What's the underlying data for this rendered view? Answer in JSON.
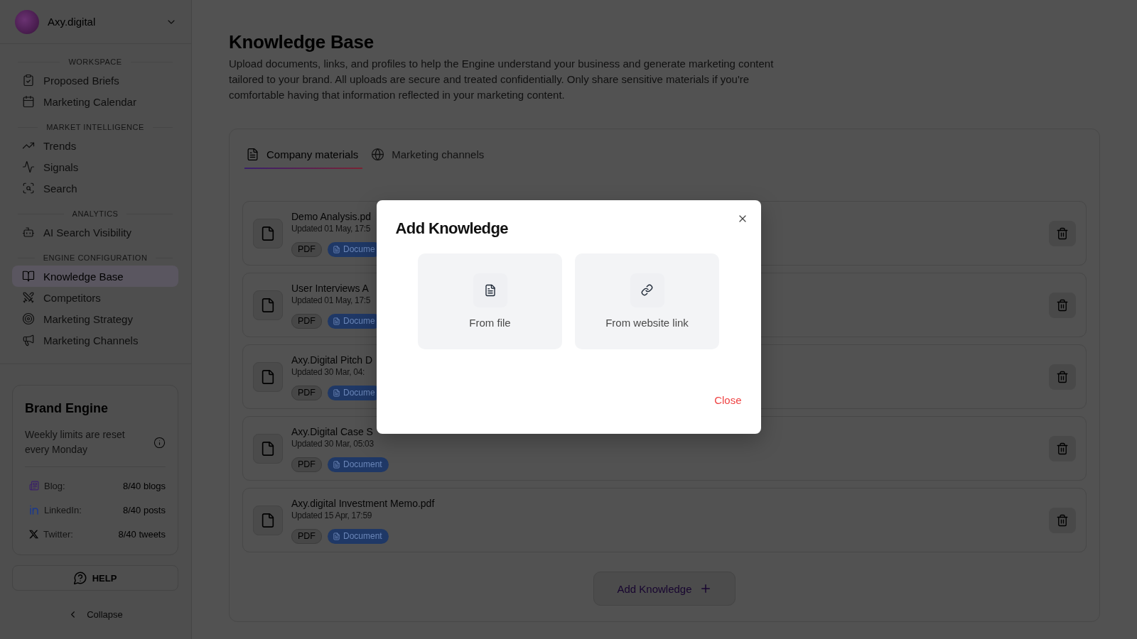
{
  "sidebar": {
    "account": {
      "name": "Axy.digital"
    },
    "sections": [
      {
        "title": "WORKSPACE",
        "items": [
          {
            "label": "Proposed Briefs",
            "selected": false
          },
          {
            "label": "Marketing Calendar",
            "selected": false
          }
        ]
      },
      {
        "title": "MARKET INTELLIGENCE",
        "items": [
          {
            "label": "Trends",
            "selected": false
          },
          {
            "label": "Signals",
            "selected": false
          },
          {
            "label": "Search",
            "selected": false
          }
        ]
      },
      {
        "title": "ANALYTICS",
        "items": [
          {
            "label": "AI Search Visibility",
            "selected": false
          }
        ]
      },
      {
        "title": "ENGINE CONFIGURATION",
        "items": [
          {
            "label": "Knowledge Base",
            "selected": true
          },
          {
            "label": "Competitors",
            "selected": false
          },
          {
            "label": "Marketing Strategy",
            "selected": false
          },
          {
            "label": "Marketing Channels",
            "selected": false
          }
        ]
      }
    ],
    "usage": {
      "title": "Brand Engine",
      "note": "Weekly limits are reset every Monday",
      "limits": [
        {
          "kind": "blog",
          "label": "Blog:",
          "value": "8/40 blogs"
        },
        {
          "kind": "linkedin",
          "label": "LinkedIn:",
          "value": "8/40 posts"
        },
        {
          "kind": "twitter",
          "label": "Twitter:",
          "value": "8/40 tweets"
        }
      ]
    },
    "help": {
      "label": "HELP"
    },
    "collapse": {
      "label": "Collapse"
    }
  },
  "page": {
    "title": "Knowledge Base",
    "description": "Upload documents, links, and profiles to help the Engine understand your business and generate marketing content tailored to your brand. All uploads are secure and treated confidentially. Only share sensitive materials if you're comfortable having that information reflected in your marketing content."
  },
  "tabs": [
    {
      "label": "Company materials",
      "selected": true
    },
    {
      "label": "Marketing channels",
      "selected": false
    }
  ],
  "documents": [
    {
      "name": "Demo Analysis.pd",
      "updated": "Updated 01 May, 17:5",
      "format": "PDF",
      "category": "Docume"
    },
    {
      "name": "User Interviews A",
      "updated": "Updated 01 May, 17:5",
      "format": "PDF",
      "category": "Docume"
    },
    {
      "name": "Axy.Digital Pitch D",
      "updated": "Updated 30 Mar, 04:",
      "format": "PDF",
      "category": "Docume"
    },
    {
      "name": "Axy.Digital Case S",
      "updated": "Updated 30 Mar, 05:03",
      "format": "PDF",
      "category": "Document"
    },
    {
      "name": "Axy.digital Investment Memo.pdf",
      "updated": "Updated 15 Apr, 17:59",
      "format": "PDF",
      "category": "Document"
    }
  ],
  "add_button": {
    "label": "Add Knowledge"
  },
  "dialog": {
    "title": "Add Knowledge",
    "options": [
      {
        "kind": "file",
        "label": "From file"
      },
      {
        "kind": "link",
        "label": "From website link"
      }
    ],
    "close": "Close"
  }
}
